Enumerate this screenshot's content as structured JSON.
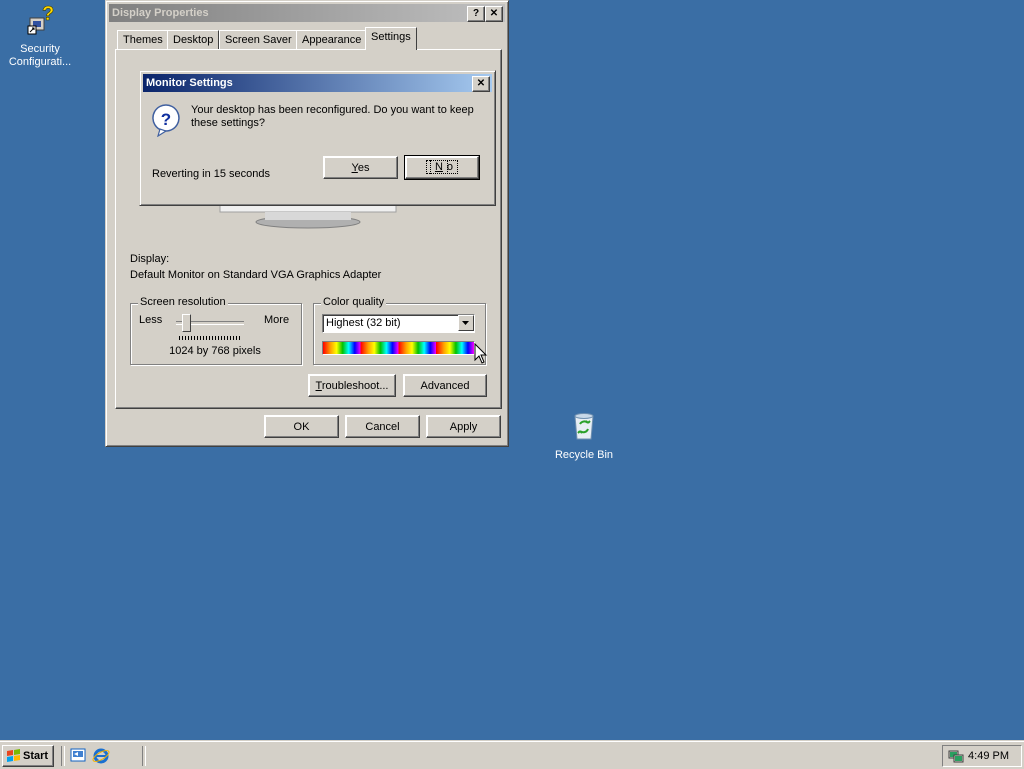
{
  "desktop": {
    "icons": [
      {
        "label": "Security Configurati..."
      },
      {
        "label": "Recycle Bin"
      }
    ]
  },
  "display_properties": {
    "title": "Display Properties",
    "help_btn": "?",
    "close_btn": "✕",
    "tabs": [
      "Themes",
      "Desktop",
      "Screen Saver",
      "Appearance",
      "Settings"
    ],
    "display_label": "Display:",
    "display_value": "Default Monitor on Standard VGA Graphics Adapter",
    "resolution": {
      "group_label": "Screen resolution",
      "less": "Less",
      "more": "More",
      "value_text": "1024 by 768 pixels",
      "slider_position": 0.15
    },
    "color_quality": {
      "group_label": "Color quality",
      "selected": "Highest (32 bit)"
    },
    "troubleshoot_btn": "Troubleshoot...",
    "advanced_btn": "Advanced",
    "ok_btn": "OK",
    "cancel_btn": "Cancel",
    "apply_btn": "Apply"
  },
  "monitor_settings": {
    "title": "Monitor Settings",
    "close_btn": "✕",
    "message": "Your desktop has been reconfigured.  Do you want to keep these settings?",
    "countdown": "Reverting in 15 seconds",
    "yes_btn": "Yes",
    "no_btn": "No"
  },
  "taskbar": {
    "start_label": "Start",
    "clock": "4:49 PM"
  },
  "colors": {
    "desktop": "#3a6ea5",
    "face": "#d4d0c8",
    "active_title": "#0a246a"
  }
}
